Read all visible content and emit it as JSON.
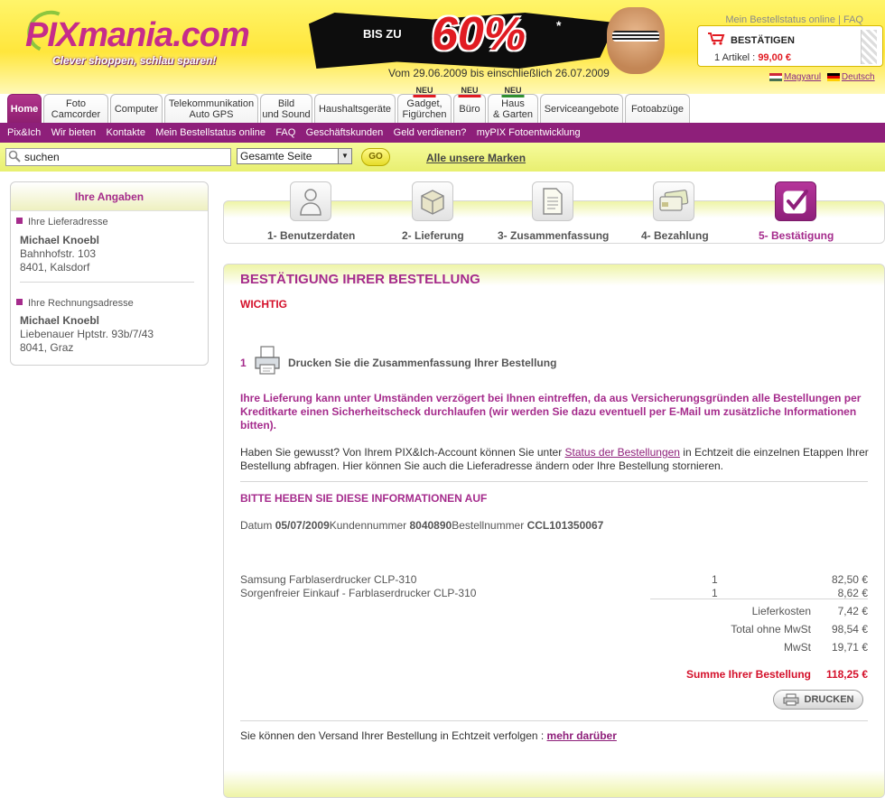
{
  "header": {
    "logo_text_1": "PIX",
    "logo_text_2": "mania.com",
    "slogan": "Clever shoppen, schlau sparen!",
    "banner_prefix": "BIS ZU",
    "banner_percent": "60%",
    "banner_star": "*",
    "banner_date": "Vom 29.06.2009 bis einschließlich 26.07.2009",
    "toplink_status": "Mein Bestellstatus online",
    "toplink_sep": " | ",
    "toplink_faq": "FAQ",
    "cart_title": "BESTÄTIGEN",
    "cart_items_prefix": "1 Artikel :",
    "cart_total": "99,00 €",
    "lang_hu": "Magyarul",
    "lang_de": "Deutsch"
  },
  "tabs": [
    {
      "l1": "Home",
      "l2": ""
    },
    {
      "l1": "Foto",
      "l2": "Camcorder"
    },
    {
      "l1": "Computer",
      "l2": ""
    },
    {
      "l1": "Telekommunikation",
      "l2": "Auto GPS"
    },
    {
      "l1": "Bild",
      "l2": "und Sound"
    },
    {
      "l1": "Haushaltsgeräte",
      "l2": ""
    },
    {
      "l1": "Gadget,",
      "l2": "Figürchen",
      "neu": "NEU"
    },
    {
      "l1": "Büro",
      "l2": "",
      "neu": "NEU"
    },
    {
      "l1": "Haus",
      "l2": "& Garten",
      "neu": "NEU"
    },
    {
      "l1": "Serviceangebote",
      "l2": ""
    },
    {
      "l1": "Fotoabzüge",
      "l2": ""
    }
  ],
  "subnav": [
    "Pix&Ich",
    "Wir bieten",
    "Kontakte",
    "Mein Bestellstatus online",
    "FAQ",
    "Geschäftskunden",
    "Geld verdienen?",
    "myPIX Fotoentwicklung"
  ],
  "search": {
    "value": "suchen",
    "scope": "Gesamte Seite",
    "go": "GO",
    "brands": "Alle unsere Marken"
  },
  "sidebar": {
    "title": "Ihre Angaben",
    "delivery_label": "Ihre Lieferadresse",
    "delivery_name": "Michael Knoebl",
    "delivery_street": "Bahnhofstr. 103",
    "delivery_city": "8401, Kalsdorf",
    "billing_label": "Ihre Rechnungsadresse",
    "billing_name": "Michael Knoebl",
    "billing_street": "Liebenauer Hptstr. 93b/7/43",
    "billing_city": "8041, Graz"
  },
  "steps": [
    {
      "label": "1- Benutzerdaten",
      "icon": "user-icon"
    },
    {
      "label": "2- Lieferung",
      "icon": "package-icon"
    },
    {
      "label": "3- Zusammenfassung",
      "icon": "document-icon"
    },
    {
      "label": "4- Bezahlung",
      "icon": "credit-card-icon"
    },
    {
      "label": "5- Bestätigung",
      "icon": "checkmark-icon"
    }
  ],
  "main": {
    "title": "BESTÄTIGUNG IHRER BESTELLUNG",
    "important": "WICHTIG",
    "print_num": "1",
    "print_text": "Drucken Sie die Zusammenfassung Ihrer Bestellung",
    "delay_text": "Ihre Lieferung kann unter Umständen verzögert bei Ihnen eintreffen, da aus Versicherungsgründen alle Bestellungen per Kreditkarte einen Sicherheitscheck durchlaufen (wir werden Sie dazu eventuell per E-Mail um zusätzliche Informationen bitten).",
    "info_1": "Haben Sie gewusst? Von Ihrem PIX&Ich-Account können Sie unter ",
    "info_link": "Status der Bestellungen",
    "info_2": " in Echtzeit die einzelnen Etappen Ihrer Bestellung abfragen. Hier können Sie auch die Lieferadresse ändern oder Ihre Bestellung stornieren.",
    "keep_info": "BITTE HEBEN SIE DIESE INFORMATIONEN AUF",
    "date_label": "Datum",
    "date_value": "05/07/2009",
    "customer_label": "Kundennummer",
    "customer_value": "8040890",
    "order_label": "Bestellnummer",
    "order_value": "CCL101350067",
    "items": [
      {
        "name": "Samsung Farblaserdrucker CLP-310",
        "qty": "1",
        "price": "82,50 €"
      },
      {
        "name": "Sorgenfreier Einkauf - Farblaserdrucker CLP-310",
        "qty": "1",
        "price": "8,62 €"
      }
    ],
    "shipping_label": "Lieferkosten",
    "shipping_value": "7,42 €",
    "net_label": "Total ohne MwSt",
    "net_value": "98,54 €",
    "vat_label": "MwSt",
    "vat_value": "19,71 €",
    "total_label": "Summe Ihrer Bestellung",
    "total_value": "118,25 €",
    "print_button": "DRUCKEN",
    "footer_text": "Sie können den Versand Ihrer Bestellung in Echtzeit verfolgen : ",
    "footer_link": "mehr darüber"
  },
  "colors": {
    "brand_purple": "#a52b8c",
    "nav_purple": "#8e1f7a",
    "alert_red": "#d4102a",
    "header_yellow": "#ffe63c"
  }
}
